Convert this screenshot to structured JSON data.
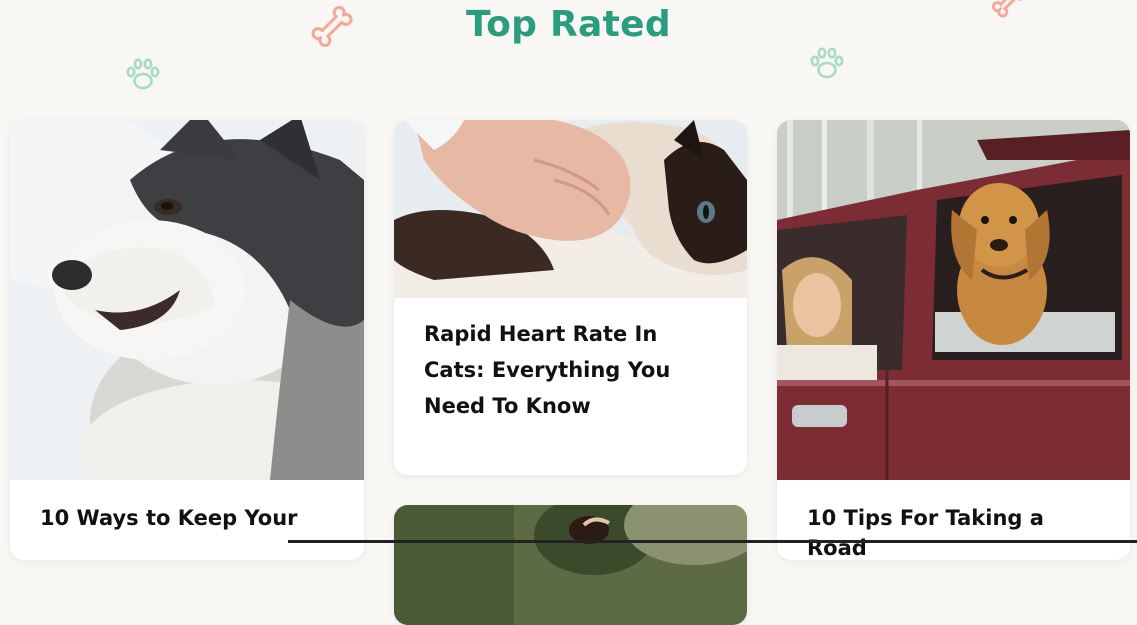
{
  "section": {
    "heading": "Top Rated"
  },
  "decorations": {
    "accent_color": "#2a9d7f",
    "bone_color": "#f2a99a",
    "paw_color": "#a8dcc0",
    "icons": [
      "bone-icon",
      "paw-icon"
    ]
  },
  "cards": [
    {
      "title": "10 Ways to Keep Your",
      "image": "husky-dog-in-snow"
    },
    {
      "title": "Rapid Heart Rate In Cats: Everything You Need To Know",
      "image": "cat-being-petted"
    },
    {
      "title": "",
      "image": "woman-and-dog-outdoors"
    },
    {
      "title": "10 Tips For Taking a Road",
      "image": "golden-retriever-in-red-truck"
    }
  ]
}
